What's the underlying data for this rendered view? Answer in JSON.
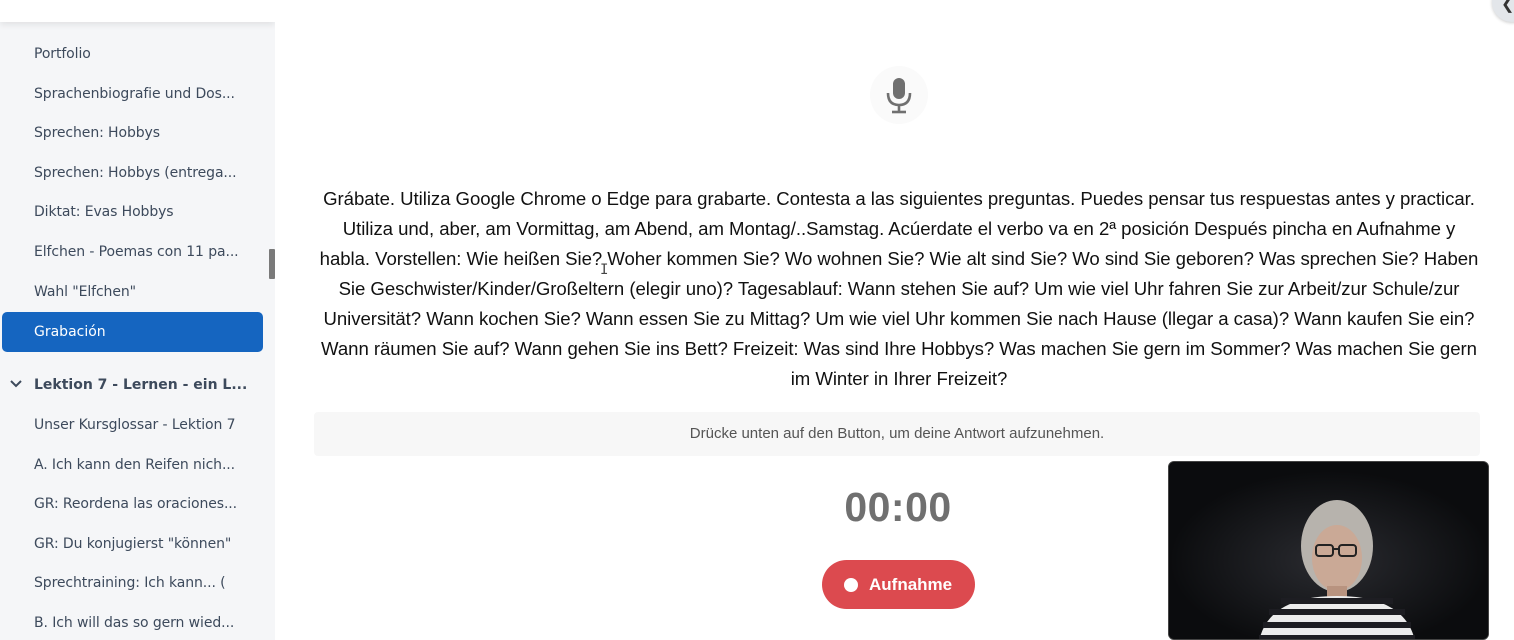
{
  "sidebar": {
    "items": [
      {
        "label": "Portfolio"
      },
      {
        "label": "Sprachenbiografie und Dos..."
      },
      {
        "label": "Sprechen: Hobbys"
      },
      {
        "label": "Sprechen: Hobbys (entrega..."
      },
      {
        "label": "Diktat: Evas Hobbys"
      },
      {
        "label": "Elfchen - Poemas con 11 pa..."
      },
      {
        "label": "Wahl \"Elfchen\""
      }
    ],
    "active_item": {
      "label": "Grabación"
    },
    "section": {
      "label": "Lektion 7 - Lernen - ein L...",
      "icon": "chevron-down-icon"
    },
    "section_items": [
      {
        "label": "Unser Kursglossar - Lektion 7"
      },
      {
        "label": "A. Ich kann den Reifen nich..."
      },
      {
        "label": "GR: Reordena las oraciones..."
      },
      {
        "label": "GR: Du konjugierst \"können\""
      },
      {
        "label": "Sprechtraining: Ich kann... ("
      },
      {
        "label": "B. Ich will das so gern wied..."
      }
    ]
  },
  "main": {
    "mic_icon": "microphone-icon",
    "prompt": "Grábate. Utiliza Google Chrome o Edge para grabarte. Contesta a las siguientes preguntas. Puedes pensar tus respuestas antes y practicar. Utiliza und, aber, am Vormittag, am Abend, am Montag/..Samstag. Acúerdate el verbo va en 2ª posición Después pincha en Aufnahme y habla. Vorstellen: Wie heißen Sie? Woher kommen Sie? Wo wohnen Sie? Wie alt sind Sie? Wo sind Sie geboren? Was sprechen Sie? Haben Sie Geschwister/Kinder/Großeltern (elegir uno)? Tagesablauf: Wann stehen Sie auf? Um wie viel Uhr fahren Sie zur Arbeit/zur Schule/zur Universität? Wann kochen Sie? Wann essen Sie zu Mittag? Um wie viel Uhr kommen Sie nach Hause (llegar a casa)? Wann kaufen Sie ein? Wann räumen Sie auf? Wann gehen Sie ins Bett? Freizeit: Was sind Ihre Hobbys? Was machen Sie gern im Sommer? Was machen Sie gern im Winter in Ihrer Freizeit?",
    "hint": "Drücke unten auf den Button, um deine Antwort aufzunehmen.",
    "timer": "00:00",
    "record_button": "Aufnahme"
  },
  "colors": {
    "active_nav": "#1565c0",
    "record_button": "#dc4a4f",
    "sidebar_bg": "#f5f6f8"
  }
}
